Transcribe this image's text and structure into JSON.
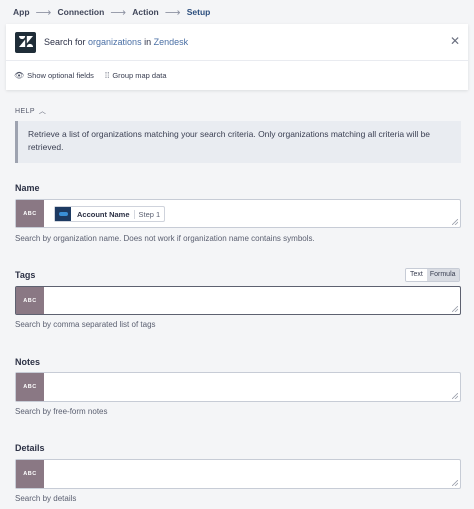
{
  "breadcrumb": {
    "steps": [
      "App",
      "Connection",
      "Action",
      "Setup"
    ]
  },
  "header": {
    "title_prefix": "Search for ",
    "title_object": "organizations",
    "title_mid": " in ",
    "title_app": "Zendesk",
    "close_icon": "close-icon",
    "options": [
      {
        "label": "Show optional fields",
        "icon": "eye-icon"
      },
      {
        "label": "Group map data",
        "icon": "group-icon"
      }
    ]
  },
  "help": {
    "toggle_label": "HELP",
    "text": "Retrieve a list of organizations matching your search criteria. Only organizations matching all criteria will be retrieved."
  },
  "fields": {
    "name": {
      "label": "Name",
      "type_badge": "ABC",
      "pill_name": "Account Name",
      "pill_step": "Step 1",
      "hint": "Search by organization name. Does not work if organization name contains symbols."
    },
    "tags": {
      "label": "Tags",
      "type_badge": "ABC",
      "toggle_text": "Text",
      "toggle_formula": "Formula",
      "hint": "Search by comma separated list of tags"
    },
    "notes": {
      "label": "Notes",
      "type_badge": "ABC",
      "hint": "Search by free-form notes"
    },
    "details": {
      "label": "Details",
      "type_badge": "ABC",
      "hint": "Search by details"
    }
  },
  "colors": {
    "badge": "#8a7884",
    "link": "#4a6fa5",
    "active_crumb": "#2d4f7e"
  }
}
